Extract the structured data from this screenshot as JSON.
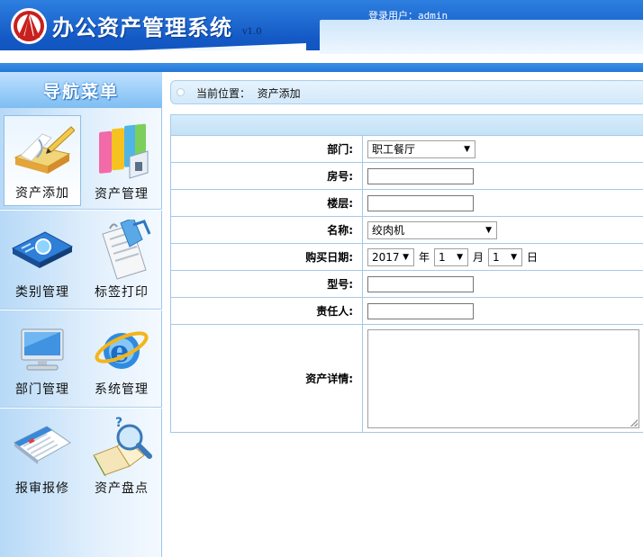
{
  "header": {
    "app_title": "办公资产管理系统",
    "version": "v1.0",
    "login_label": "登录用户：",
    "login_user": "admin"
  },
  "sidebar": {
    "title": "导航菜单",
    "items": [
      {
        "label": "资产添加",
        "icon": "pencil-book-icon",
        "active": true
      },
      {
        "label": "资产管理",
        "icon": "books-icon",
        "active": false
      },
      {
        "label": "类别管理",
        "icon": "category-board-icon",
        "active": false
      },
      {
        "label": "标签打印",
        "icon": "print-label-icon",
        "active": false
      },
      {
        "label": "部门管理",
        "icon": "monitor-icon",
        "active": false
      },
      {
        "label": "系统管理",
        "icon": "ie-globe-icon",
        "active": false
      },
      {
        "label": "报审报修",
        "icon": "calendar-icon",
        "active": false
      },
      {
        "label": "资产盘点",
        "icon": "magnifier-book-icon",
        "active": false
      }
    ]
  },
  "breadcrumb": {
    "label": "当前位置：",
    "current": "资产添加"
  },
  "form": {
    "department_label": "部门:",
    "department_value": "职工餐厅",
    "room_label": "房号:",
    "room_value": "",
    "floor_label": "楼层:",
    "floor_value": "",
    "name_label": "名称:",
    "name_value": "绞肉机",
    "purchase_date_label": "购买日期:",
    "year_value": "2017",
    "year_unit": "年",
    "month_value": "1",
    "month_unit": "月",
    "day_value": "1",
    "day_unit": "日",
    "model_label": "型号:",
    "model_value": "",
    "owner_label": "责任人:",
    "owner_value": "",
    "details_label": "资产详情:",
    "details_value": ""
  },
  "colors": {
    "header_blue": "#1358c4",
    "sidebar_bg": "#e2f0fc",
    "table_border": "#a6c8e6"
  }
}
